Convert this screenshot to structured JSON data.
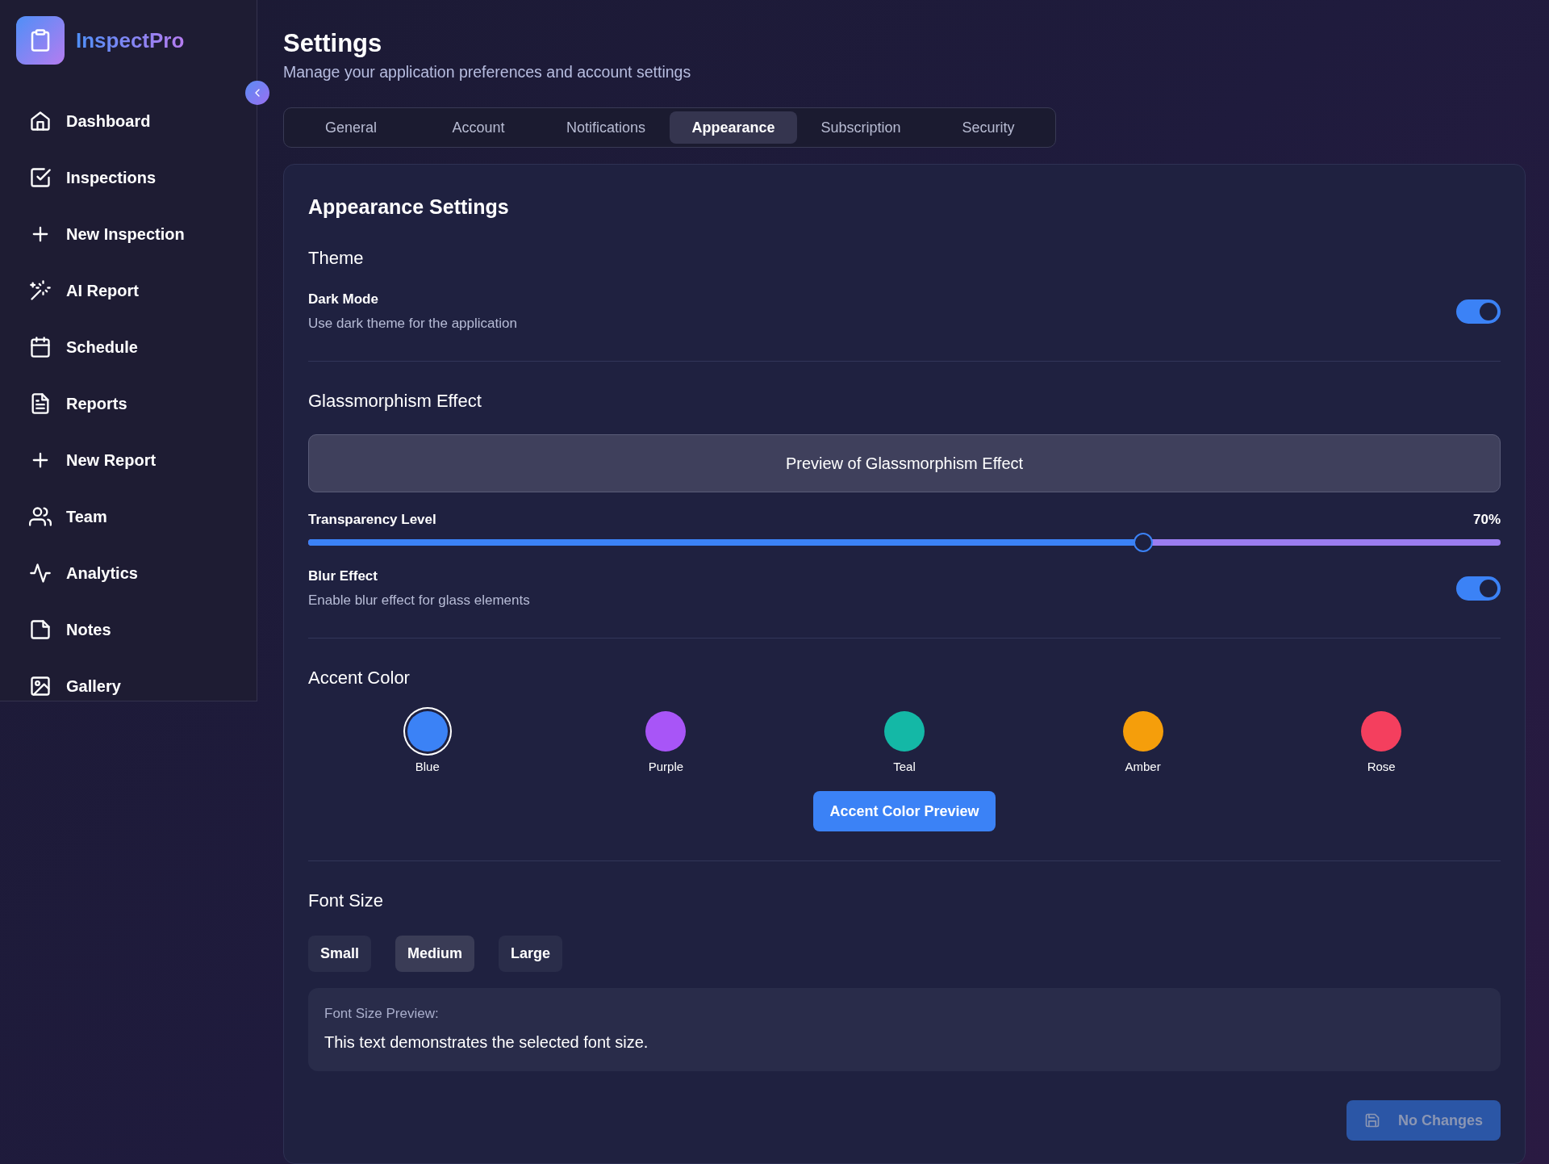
{
  "app": {
    "name": "InspectPro"
  },
  "sidebar": {
    "items": [
      {
        "label": "Dashboard"
      },
      {
        "label": "Inspections"
      },
      {
        "label": "New Inspection"
      },
      {
        "label": "AI Report"
      },
      {
        "label": "Schedule"
      },
      {
        "label": "Reports"
      },
      {
        "label": "New Report"
      },
      {
        "label": "Team"
      },
      {
        "label": "Analytics"
      },
      {
        "label": "Notes"
      },
      {
        "label": "Gallery"
      }
    ]
  },
  "header": {
    "title": "Settings",
    "subtitle": "Manage your application preferences and account settings"
  },
  "tabs": [
    {
      "label": "General",
      "selected": false
    },
    {
      "label": "Account",
      "selected": false
    },
    {
      "label": "Notifications",
      "selected": false
    },
    {
      "label": "Appearance",
      "selected": true
    },
    {
      "label": "Subscription",
      "selected": false
    },
    {
      "label": "Security",
      "selected": false
    }
  ],
  "card": {
    "title": "Appearance Settings",
    "sections": [
      {
        "title": "Theme",
        "items": [
          {
            "kind": "toggle",
            "label": "Dark Mode",
            "description": "Use dark theme for the application",
            "on": true
          }
        ]
      },
      {
        "title": "Glassmorphism Effect",
        "items": [
          {
            "kind": "preview",
            "text": "Preview of Glassmorphism Effect"
          },
          {
            "kind": "slider",
            "label": "Transparency Level",
            "reading": "70%",
            "level": 0.7
          },
          {
            "kind": "toggle",
            "label": "Blur Effect",
            "description": "Enable blur effect for glass elements",
            "on": true
          }
        ]
      },
      {
        "title": "Accent Color",
        "items": [
          {
            "kind": "swatches",
            "options": [
              {
                "name": "Blue",
                "color": "#3b82f6",
                "selected": true
              },
              {
                "name": "Purple",
                "color": "#a855f7",
                "selected": false
              },
              {
                "name": "Teal",
                "color": "#14b8a6",
                "selected": false
              },
              {
                "name": "Amber",
                "color": "#f59e0b",
                "selected": false
              },
              {
                "name": "Rose",
                "color": "#f43f5e",
                "selected": false
              }
            ]
          },
          {
            "kind": "button",
            "label": "Accent Color Preview"
          }
        ]
      },
      {
        "title": "Font Size",
        "items": [
          {
            "kind": "choices",
            "options": [
              {
                "label": "Small",
                "selected": false
              },
              {
                "label": "Medium",
                "selected": true
              },
              {
                "label": "Large",
                "selected": false
              }
            ]
          },
          {
            "kind": "sample",
            "caption": "Font Size Preview:",
            "text": "This text demonstrates the selected font size."
          }
        ]
      }
    ],
    "save_button": {
      "label": "No Changes",
      "disabled": true
    }
  }
}
